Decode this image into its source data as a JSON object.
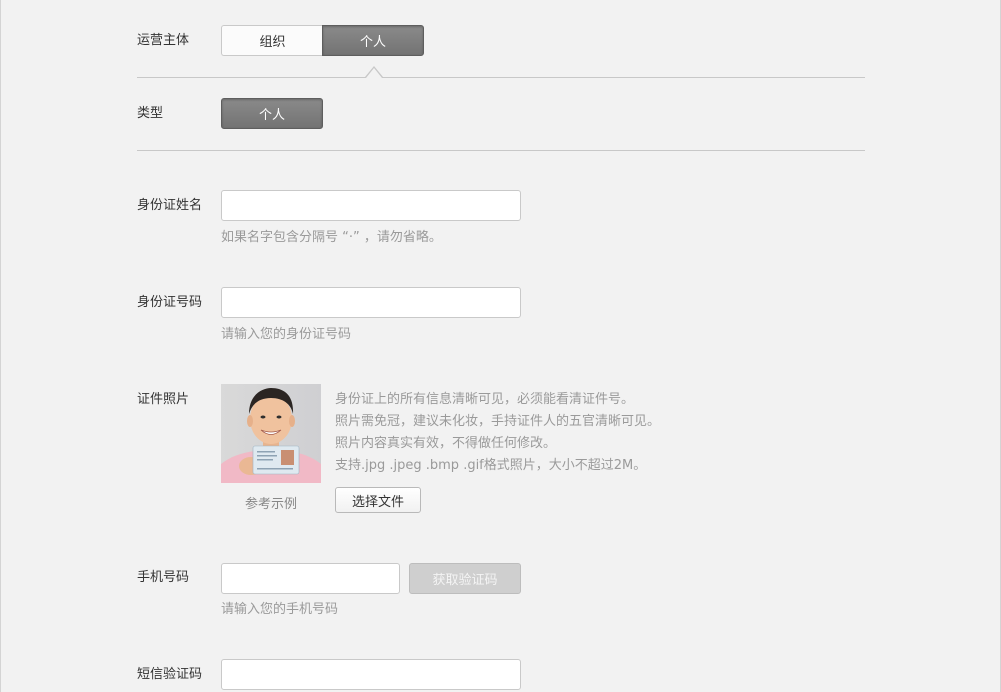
{
  "operator": {
    "label": "运营主体",
    "options": [
      "组织",
      "个人"
    ],
    "selected": "个人"
  },
  "type": {
    "label": "类型",
    "value": "个人"
  },
  "id_name": {
    "label": "身份证姓名",
    "value": "",
    "placeholder": "",
    "hint": "如果名字包含分隔号 “·” ，请勿省略。"
  },
  "id_number": {
    "label": "身份证号码",
    "value": "",
    "placeholder": "",
    "hint": "请输入您的身份证号码"
  },
  "id_photo": {
    "label": "证件照片",
    "example_caption": "参考示例",
    "requirements": [
      "身份证上的所有信息清晰可见，必须能看清证件号。",
      "照片需免冠，建议未化妆，手持证件人的五官清晰可见。",
      "照片内容真实有效，不得做任何修改。",
      "支持.jpg .jpeg .bmp .gif格式照片，大小不超过2M。"
    ],
    "choose_file_label": "选择文件"
  },
  "phone": {
    "label": "手机号码",
    "value": "",
    "placeholder": "",
    "get_code_label": "获取验证码",
    "hint": "请输入您的手机号码"
  },
  "sms_code": {
    "label": "短信验证码",
    "value": "",
    "placeholder": ""
  },
  "colors": {
    "background": "#f2f2f2",
    "selected_segment": "#7d7d7d",
    "hint_text": "#9a9a9a",
    "disabled_button": "#cfcfcf"
  }
}
